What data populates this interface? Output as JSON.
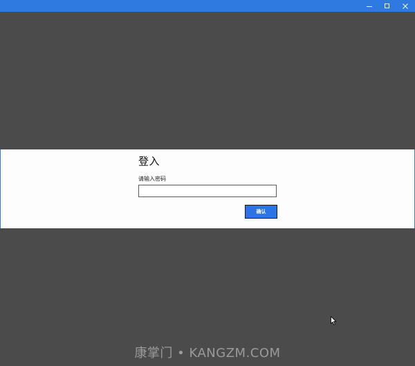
{
  "window": {
    "controls": {
      "minimize_icon": "minimize-icon",
      "maximize_icon": "maximize-icon",
      "close_icon": "close-icon"
    },
    "titlebar_color": "#2f7ae0",
    "background_color": "#4b4b4b"
  },
  "dialog": {
    "title": "登入",
    "prompt": "请输入密码",
    "password_value": "",
    "confirm_label": "确认",
    "accent_color": "#2e73e6"
  },
  "watermark": {
    "text": "康掌门 • KANGZM.COM"
  }
}
